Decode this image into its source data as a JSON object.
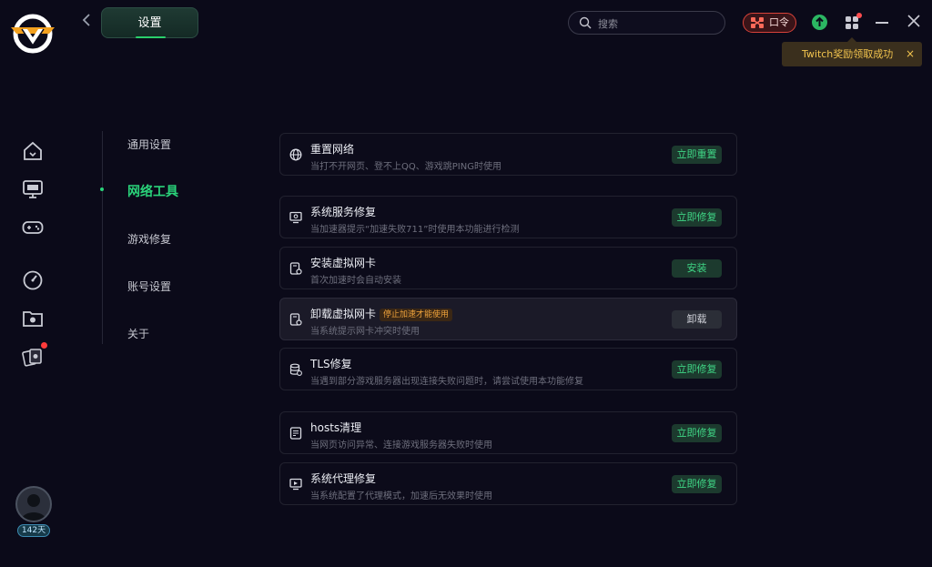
{
  "header": {
    "title": "设置",
    "search_placeholder": "搜索",
    "kouling_label": "口令",
    "toast": "Twitch奖励领取成功",
    "toast_close": "×"
  },
  "nav": {
    "items": [
      "通用设置",
      "网络工具",
      "游戏修复",
      "账号设置",
      "关于"
    ],
    "active": "网络工具"
  },
  "user": {
    "days": "142天"
  },
  "cards": [
    {
      "title": "重置网络",
      "tag": "",
      "sub": "当打不开网页、登不上QQ、游戏跳PING时使用",
      "button": "立即重置",
      "icon": "globe-icon"
    },
    {
      "title": "系统服务修复",
      "tag": "",
      "sub": "当加速器提示“加速失败711”时使用本功能进行检测",
      "button": "立即修复",
      "icon": "monitor-icon"
    },
    {
      "title": "安装虚拟网卡",
      "tag": "",
      "sub": "首次加速时会自动安装",
      "button": "安装",
      "icon": "card-gear-icon"
    },
    {
      "title": "卸载虚拟网卡",
      "tag": "停止加速才能使用",
      "sub": "当系统提示网卡冲突时使用",
      "button": "卸载",
      "icon": "card-gear-icon"
    },
    {
      "title": "TLS修复",
      "tag": "",
      "sub": "当遇到部分游戏服务器出现连接失败问题时，请尝试使用本功能修复",
      "button": "立即修复",
      "icon": "database-icon"
    },
    {
      "title": "hosts清理",
      "tag": "",
      "sub": "当网页访问异常、连接游戏服务器失败时使用",
      "button": "立即修复",
      "icon": "file-icon"
    },
    {
      "title": "系统代理修复",
      "tag": "",
      "sub": "当系统配置了代理模式，加速后无效果时使用",
      "button": "立即修复",
      "icon": "screen-icon"
    }
  ],
  "colors": {
    "accent": "#2ad37a",
    "background": "#0b0a19",
    "warning": "#f0a33b"
  }
}
